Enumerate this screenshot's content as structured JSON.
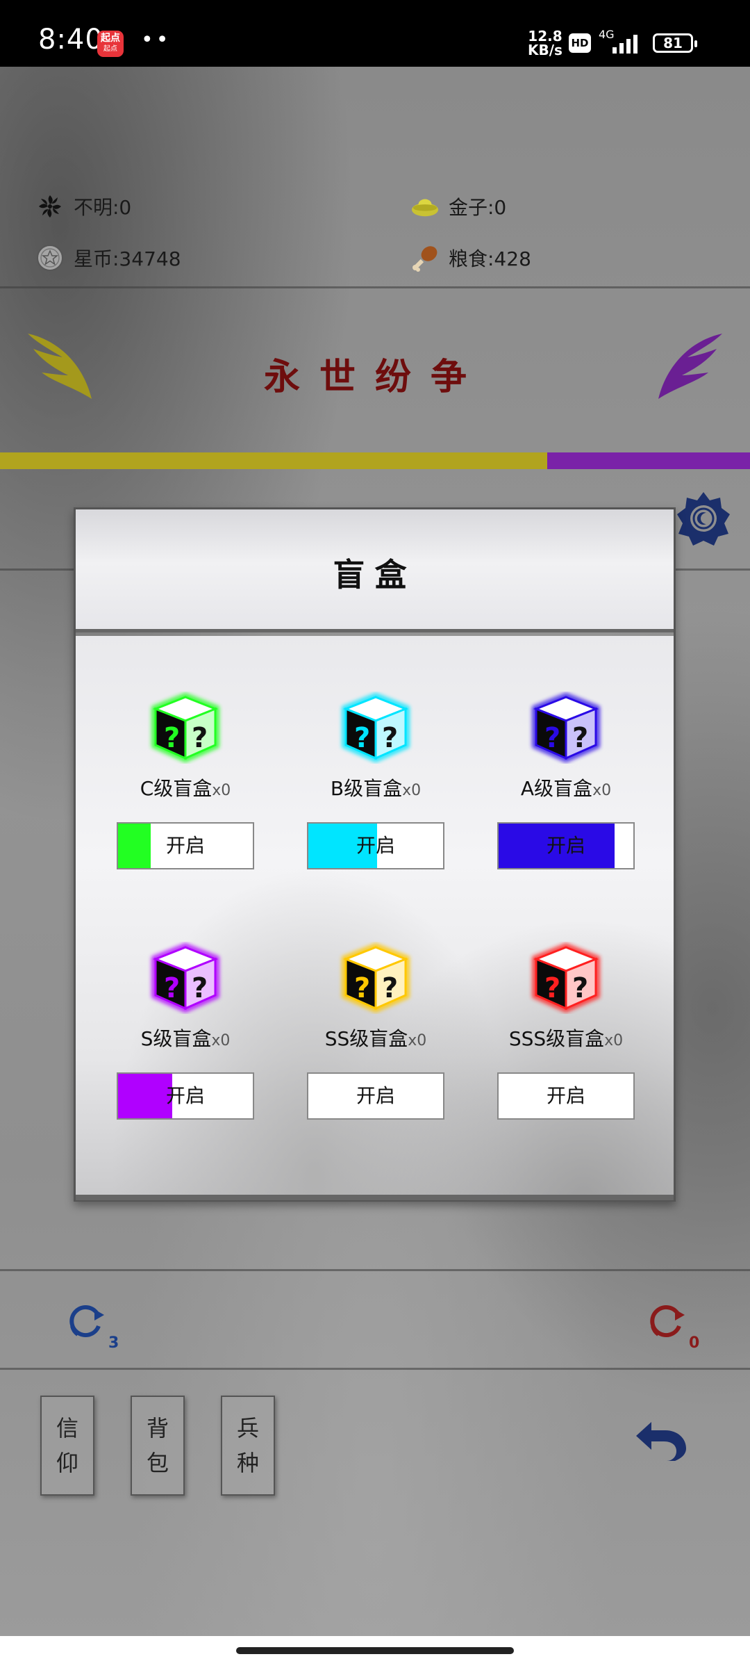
{
  "status_bar": {
    "time": "8:40",
    "app_badge_top": "起点",
    "app_badge_bottom": "起点",
    "dots": "••",
    "net_speed_value": "12.8",
    "net_speed_unit": "KB/s",
    "hd": "HD",
    "network": "4G",
    "battery": "81"
  },
  "resources": {
    "unknown": "不明:0",
    "gold": "金子:0",
    "star_coin": "星币:34748",
    "food": "粮食:428"
  },
  "faction_title": "永世纷争",
  "faction_balance": {
    "yellow_fraction": 0.73,
    "yellow_color": "#b1a41e",
    "purple_color": "#7a22a8"
  },
  "modal": {
    "title": "盲盒",
    "boxes": [
      {
        "label": "C级盲盒",
        "count": "x0",
        "button": "开启",
        "color": "#22ff22",
        "fill": 0.24
      },
      {
        "label": "B级盲盒",
        "count": "x0",
        "button": "开启",
        "color": "#00e5ff",
        "fill": 0.51
      },
      {
        "label": "A级盲盒",
        "count": "x0",
        "button": "开启",
        "color": "#2a0ae6",
        "fill": 0.86
      },
      {
        "label": "S级盲盒",
        "count": "x0",
        "button": "开启",
        "color": "#b000ff",
        "fill": 0.4
      },
      {
        "label": "SS级盲盒",
        "count": "x0",
        "button": "开启",
        "color": "#ffc800",
        "fill": 0
      },
      {
        "label": "SSS级盲盒",
        "count": "x0",
        "button": "开启",
        "color": "#ff2020",
        "fill": 0
      }
    ]
  },
  "refresh": {
    "left_count": "3",
    "right_count": "0"
  },
  "side_buttons": [
    {
      "line1": "信",
      "line2": "仰"
    },
    {
      "line1": "背",
      "line2": "包"
    },
    {
      "line1": "兵",
      "line2": "种"
    }
  ]
}
